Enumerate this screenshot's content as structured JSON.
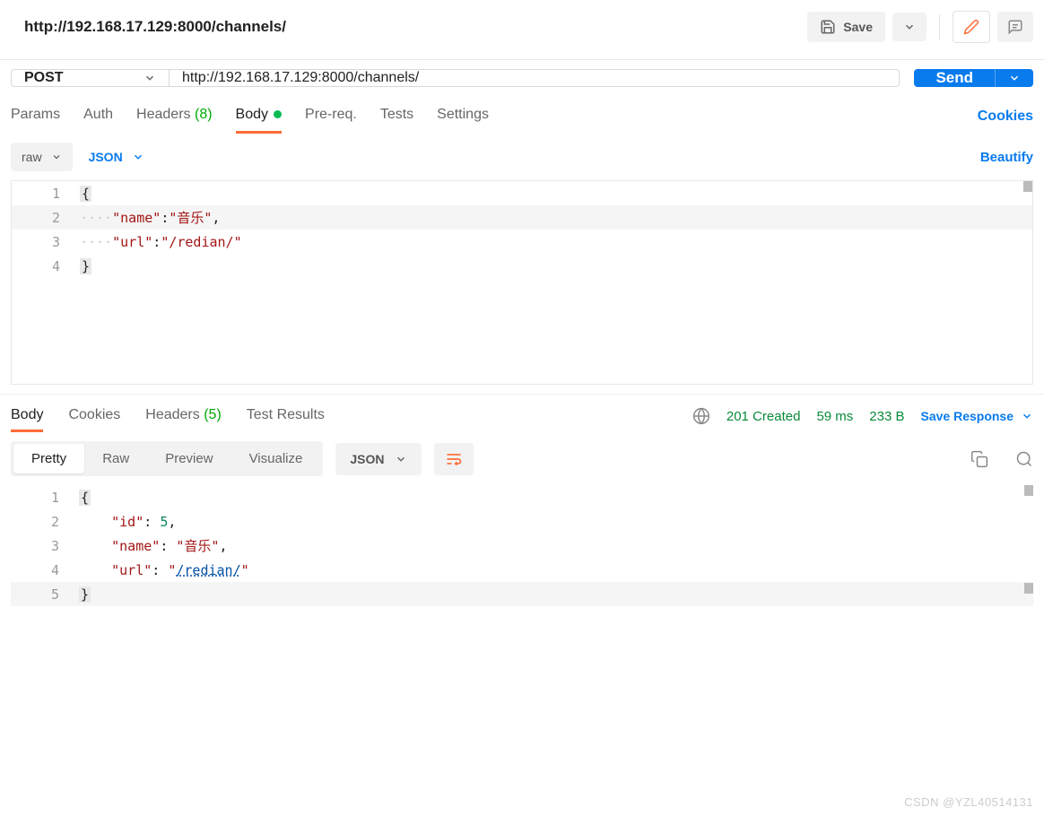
{
  "header": {
    "tab_title": "http://192.168.17.129:8000/channels/",
    "save_label": "Save"
  },
  "request": {
    "method": "POST",
    "url": "http://192.168.17.129:8000/channels/",
    "send_label": "Send",
    "tabs": {
      "params": "Params",
      "auth": "Auth",
      "headers": "Headers",
      "headers_count": "(8)",
      "body": "Body",
      "prereq": "Pre-req.",
      "tests": "Tests",
      "settings": "Settings"
    },
    "cookies_link": "Cookies",
    "body_opts": {
      "raw": "raw",
      "lang": "JSON",
      "beautify": "Beautify"
    },
    "body_lines": [
      "1",
      "2",
      "3",
      "4"
    ],
    "body_tokens": {
      "l2_key": "\"name\"",
      "l2_val": "\"音乐\"",
      "l3_key": "\"url\"",
      "l3_val": "\"/redian/\""
    }
  },
  "response": {
    "tabs": {
      "body": "Body",
      "cookies": "Cookies",
      "headers": "Headers",
      "headers_count": "(5)",
      "tests": "Test Results"
    },
    "status": "201 Created",
    "time": "59 ms",
    "size": "233 B",
    "save_resp": "Save Response",
    "view": {
      "pretty": "Pretty",
      "raw": "Raw",
      "preview": "Preview",
      "visualize": "Visualize",
      "fmt": "JSON"
    },
    "body_lines": [
      "1",
      "2",
      "3",
      "4",
      "5"
    ],
    "body_tokens": {
      "l2_key": "\"id\"",
      "l2_val": "5",
      "l3_key": "\"name\"",
      "l3_val": "\"音乐\"",
      "l4_key": "\"url\"",
      "l4_val_pre": "\"",
      "l4_val_link": "/redian/",
      "l4_val_post": "\""
    }
  },
  "watermark": "CSDN @YZL40514131"
}
